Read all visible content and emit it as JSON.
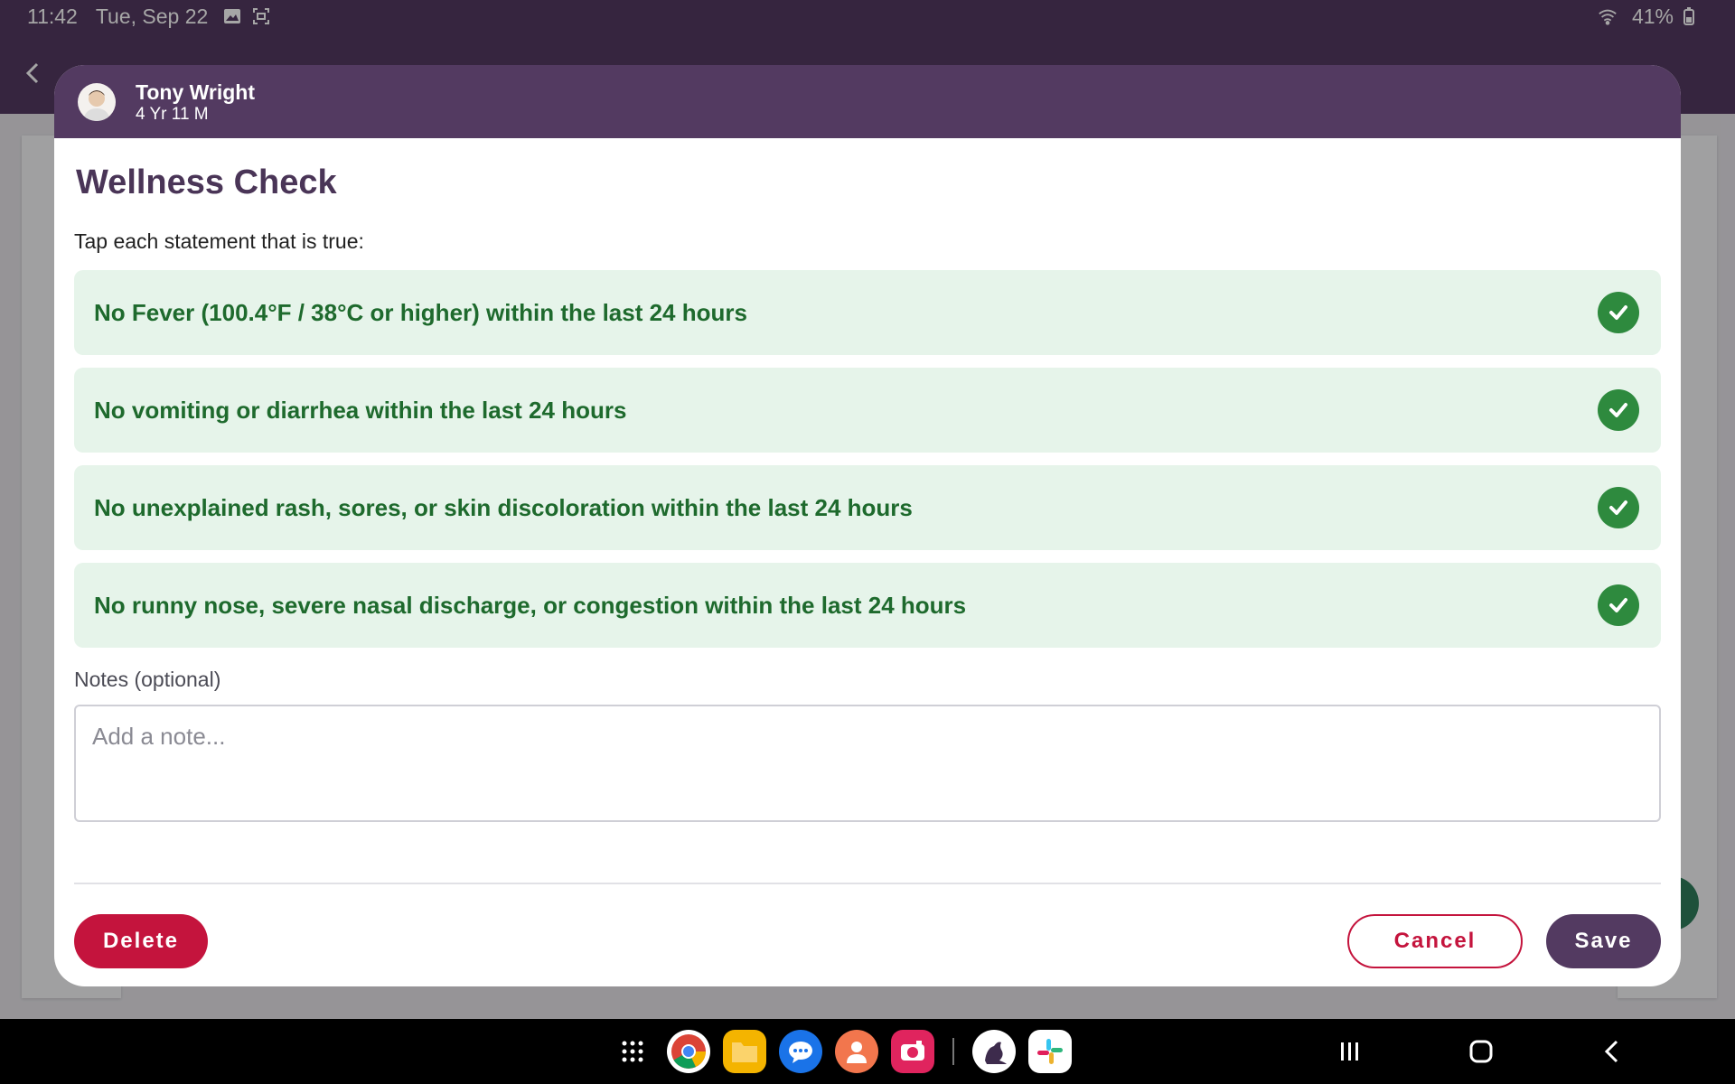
{
  "status_bar": {
    "time": "11:42",
    "date": "Tue, Sep 22",
    "battery": "41%"
  },
  "dialog": {
    "child": {
      "name": "Tony Wright",
      "age": "4 Yr 11 M"
    },
    "title": "Wellness Check",
    "instruction": "Tap each statement that is true:",
    "statements": [
      {
        "label": "No Fever (100.4°F / 38°C or higher) within the last 24 hours",
        "checked": true
      },
      {
        "label": "No vomiting or diarrhea within the last 24 hours",
        "checked": true
      },
      {
        "label": "No unexplained rash, sores, or skin discoloration within the last 24 hours",
        "checked": true
      },
      {
        "label": "No runny nose, severe nasal discharge, or congestion within the last 24 hours",
        "checked": true
      }
    ],
    "notes": {
      "label": "Notes (optional)",
      "placeholder": "Add a note...",
      "value": ""
    },
    "buttons": {
      "delete": "Delete",
      "cancel": "Cancel",
      "save": "Save"
    }
  },
  "colors": {
    "brand": "#533a61",
    "check_green": "#2e8a3e",
    "statement_bg": "#e6f4ea",
    "delete_red": "#c4143d"
  },
  "dock": {
    "apps": [
      "apps-grid-icon",
      "chrome-icon",
      "files-icon",
      "messages-icon",
      "contacts-icon",
      "camera-icon",
      "kangaroo-app-icon",
      "slack-icon"
    ]
  }
}
